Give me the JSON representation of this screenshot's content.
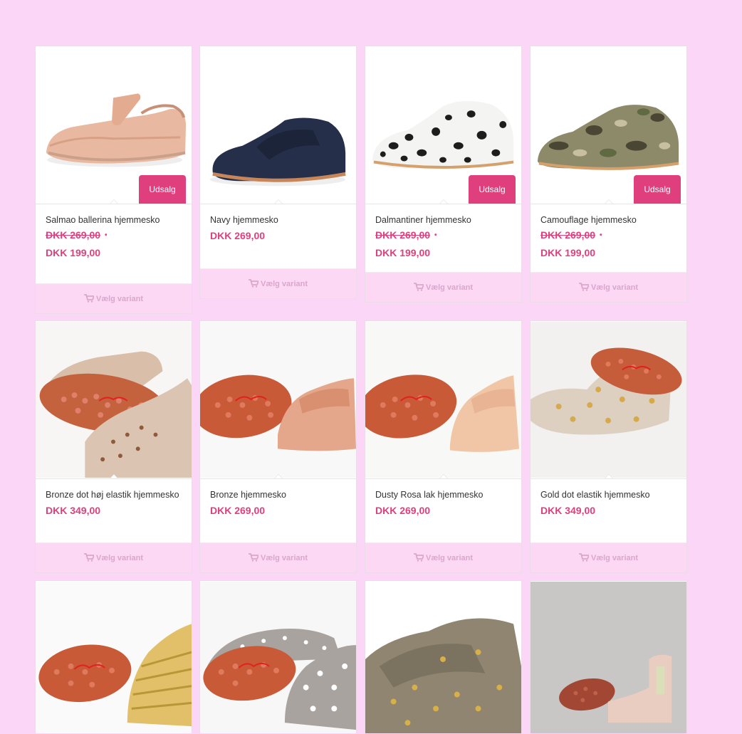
{
  "products": [
    {
      "name": "Salmao ballerina hjemmesko",
      "old_price": "DKK 269,00",
      "price": "DKK 199,00",
      "badge": "Udsalg",
      "button": "Vælg variant",
      "image": "rose-gold-ballerina"
    },
    {
      "name": "Navy hjemmesko",
      "old_price": "",
      "price": "DKK 269,00",
      "badge": "",
      "button": "Vælg variant",
      "image": "navy-velcro-shoe"
    },
    {
      "name": "Dalmantiner hjemmesko",
      "old_price": "DKK 269,00",
      "price": "DKK 199,00",
      "badge": "Udsalg",
      "button": "Vælg variant",
      "image": "dalmatian-shoe"
    },
    {
      "name": "Camouflage hjemmesko",
      "old_price": "DKK 269,00",
      "price": "DKK 199,00",
      "badge": "Udsalg",
      "button": "Vælg variant",
      "image": "camouflage-shoe"
    },
    {
      "name": "Bronze dot høj elastik hjemmesko",
      "old_price": "",
      "price": "DKK 349,00",
      "badge": "",
      "button": "Vælg variant",
      "image": "bronze-dot-boot"
    },
    {
      "name": "Bronze hjemmesko",
      "old_price": "",
      "price": "DKK 269,00",
      "badge": "",
      "button": "Vælg variant",
      "image": "bronze-shoe"
    },
    {
      "name": "Dusty Rosa lak hjemmesko",
      "old_price": "",
      "price": "DKK 269,00",
      "badge": "",
      "button": "Vælg variant",
      "image": "dusty-rose-patent-shoe"
    },
    {
      "name": "Gold dot elastik hjemmesko",
      "old_price": "",
      "price": "DKK 349,00",
      "badge": "",
      "button": "Vælg variant",
      "image": "gold-dot-boot"
    },
    {
      "name": "",
      "old_price": "",
      "price": "",
      "badge": "",
      "button": "",
      "image": "gold-striped-shoe"
    },
    {
      "name": "",
      "old_price": "",
      "price": "",
      "badge": "",
      "button": "",
      "image": "grey-dot-shoe"
    },
    {
      "name": "",
      "old_price": "",
      "price": "",
      "badge": "",
      "button": "",
      "image": "grey-gold-dot-shoe"
    },
    {
      "name": "",
      "old_price": "",
      "price": "",
      "badge": "",
      "button": "",
      "image": "pink-chelsea-boot"
    }
  ],
  "colors": {
    "accent": "#df3f7d",
    "page_bg": "#fbd6f6",
    "button_bg": "#fcd8f5",
    "button_text": "#d9a7cb"
  }
}
